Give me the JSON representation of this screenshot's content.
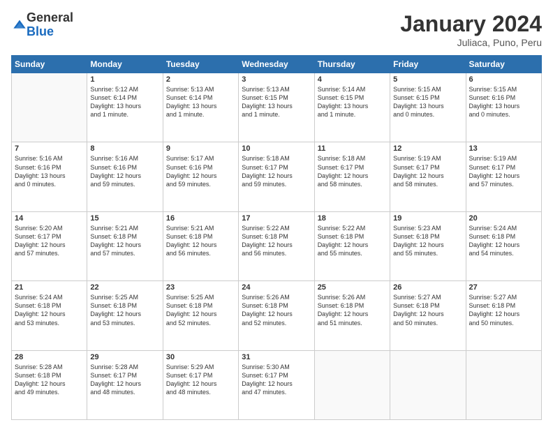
{
  "header": {
    "logo": {
      "general": "General",
      "blue": "Blue"
    },
    "month": "January 2024",
    "location": "Juliaca, Puno, Peru"
  },
  "days_of_week": [
    "Sunday",
    "Monday",
    "Tuesday",
    "Wednesday",
    "Thursday",
    "Friday",
    "Saturday"
  ],
  "weeks": [
    [
      {
        "day": null,
        "info": null
      },
      {
        "day": "1",
        "sunrise": "5:12 AM",
        "sunset": "6:14 PM",
        "daylight": "13 hours and 1 minute."
      },
      {
        "day": "2",
        "sunrise": "5:13 AM",
        "sunset": "6:14 PM",
        "daylight": "13 hours and 1 minute."
      },
      {
        "day": "3",
        "sunrise": "5:13 AM",
        "sunset": "6:15 PM",
        "daylight": "13 hours and 1 minute."
      },
      {
        "day": "4",
        "sunrise": "5:14 AM",
        "sunset": "6:15 PM",
        "daylight": "13 hours and 1 minute."
      },
      {
        "day": "5",
        "sunrise": "5:15 AM",
        "sunset": "6:15 PM",
        "daylight": "13 hours and 0 minutes."
      },
      {
        "day": "6",
        "sunrise": "5:15 AM",
        "sunset": "6:16 PM",
        "daylight": "13 hours and 0 minutes."
      }
    ],
    [
      {
        "day": "7",
        "sunrise": "5:16 AM",
        "sunset": "6:16 PM",
        "daylight": "13 hours and 0 minutes."
      },
      {
        "day": "8",
        "sunrise": "5:16 AM",
        "sunset": "6:16 PM",
        "daylight": "12 hours and 59 minutes."
      },
      {
        "day": "9",
        "sunrise": "5:17 AM",
        "sunset": "6:16 PM",
        "daylight": "12 hours and 59 minutes."
      },
      {
        "day": "10",
        "sunrise": "5:18 AM",
        "sunset": "6:17 PM",
        "daylight": "12 hours and 59 minutes."
      },
      {
        "day": "11",
        "sunrise": "5:18 AM",
        "sunset": "6:17 PM",
        "daylight": "12 hours and 58 minutes."
      },
      {
        "day": "12",
        "sunrise": "5:19 AM",
        "sunset": "6:17 PM",
        "daylight": "12 hours and 58 minutes."
      },
      {
        "day": "13",
        "sunrise": "5:19 AM",
        "sunset": "6:17 PM",
        "daylight": "12 hours and 57 minutes."
      }
    ],
    [
      {
        "day": "14",
        "sunrise": "5:20 AM",
        "sunset": "6:17 PM",
        "daylight": "12 hours and 57 minutes."
      },
      {
        "day": "15",
        "sunrise": "5:21 AM",
        "sunset": "6:18 PM",
        "daylight": "12 hours and 57 minutes."
      },
      {
        "day": "16",
        "sunrise": "5:21 AM",
        "sunset": "6:18 PM",
        "daylight": "12 hours and 56 minutes."
      },
      {
        "day": "17",
        "sunrise": "5:22 AM",
        "sunset": "6:18 PM",
        "daylight": "12 hours and 56 minutes."
      },
      {
        "day": "18",
        "sunrise": "5:22 AM",
        "sunset": "6:18 PM",
        "daylight": "12 hours and 55 minutes."
      },
      {
        "day": "19",
        "sunrise": "5:23 AM",
        "sunset": "6:18 PM",
        "daylight": "12 hours and 55 minutes."
      },
      {
        "day": "20",
        "sunrise": "5:24 AM",
        "sunset": "6:18 PM",
        "daylight": "12 hours and 54 minutes."
      }
    ],
    [
      {
        "day": "21",
        "sunrise": "5:24 AM",
        "sunset": "6:18 PM",
        "daylight": "12 hours and 53 minutes."
      },
      {
        "day": "22",
        "sunrise": "5:25 AM",
        "sunset": "6:18 PM",
        "daylight": "12 hours and 53 minutes."
      },
      {
        "day": "23",
        "sunrise": "5:25 AM",
        "sunset": "6:18 PM",
        "daylight": "12 hours and 52 minutes."
      },
      {
        "day": "24",
        "sunrise": "5:26 AM",
        "sunset": "6:18 PM",
        "daylight": "12 hours and 52 minutes."
      },
      {
        "day": "25",
        "sunrise": "5:26 AM",
        "sunset": "6:18 PM",
        "daylight": "12 hours and 51 minutes."
      },
      {
        "day": "26",
        "sunrise": "5:27 AM",
        "sunset": "6:18 PM",
        "daylight": "12 hours and 50 minutes."
      },
      {
        "day": "27",
        "sunrise": "5:27 AM",
        "sunset": "6:18 PM",
        "daylight": "12 hours and 50 minutes."
      }
    ],
    [
      {
        "day": "28",
        "sunrise": "5:28 AM",
        "sunset": "6:18 PM",
        "daylight": "12 hours and 49 minutes."
      },
      {
        "day": "29",
        "sunrise": "5:28 AM",
        "sunset": "6:17 PM",
        "daylight": "12 hours and 48 minutes."
      },
      {
        "day": "30",
        "sunrise": "5:29 AM",
        "sunset": "6:17 PM",
        "daylight": "12 hours and 48 minutes."
      },
      {
        "day": "31",
        "sunrise": "5:30 AM",
        "sunset": "6:17 PM",
        "daylight": "12 hours and 47 minutes."
      },
      {
        "day": null,
        "info": null
      },
      {
        "day": null,
        "info": null
      },
      {
        "day": null,
        "info": null
      }
    ]
  ],
  "labels": {
    "sunrise": "Sunrise:",
    "sunset": "Sunset:",
    "daylight": "Daylight:"
  },
  "colors": {
    "header_bg": "#2c6fad",
    "header_text": "#ffffff"
  }
}
